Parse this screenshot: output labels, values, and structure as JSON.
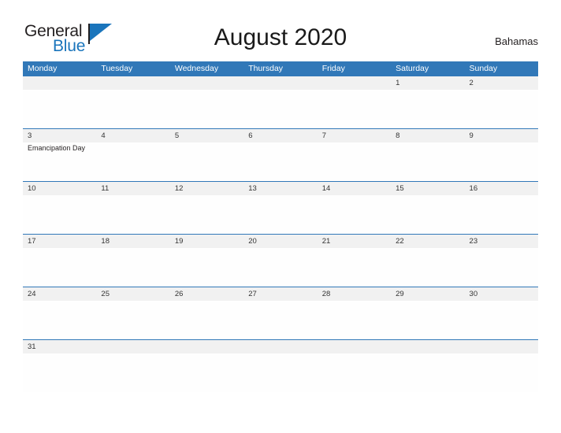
{
  "brand": {
    "name_part1": "General",
    "name_part2": "Blue",
    "flag_icon": "flag-triangle-icon",
    "color_dark": "#231f20",
    "color_blue": "#1a75bc"
  },
  "header": {
    "title": "August 2020",
    "country": "Bahamas"
  },
  "colors": {
    "header_bar": "#3178b8",
    "date_strip": "#f1f1f1",
    "row_divider": "#3178b8",
    "page_background": "#ffffff",
    "text": "#333333"
  },
  "calendar": {
    "month": "August",
    "year": "2020",
    "weekday_headers": [
      "Monday",
      "Tuesday",
      "Wednesday",
      "Thursday",
      "Friday",
      "Saturday",
      "Sunday"
    ],
    "weeks": [
      {
        "dates": [
          "",
          "",
          "",
          "",
          "",
          "1",
          "2"
        ],
        "events": [
          "",
          "",
          "",
          "",
          "",
          "",
          ""
        ]
      },
      {
        "dates": [
          "3",
          "4",
          "5",
          "6",
          "7",
          "8",
          "9"
        ],
        "events": [
          "Emancipation Day",
          "",
          "",
          "",
          "",
          "",
          ""
        ]
      },
      {
        "dates": [
          "10",
          "11",
          "12",
          "13",
          "14",
          "15",
          "16"
        ],
        "events": [
          "",
          "",
          "",
          "",
          "",
          "",
          ""
        ]
      },
      {
        "dates": [
          "17",
          "18",
          "19",
          "20",
          "21",
          "22",
          "23"
        ],
        "events": [
          "",
          "",
          "",
          "",
          "",
          "",
          ""
        ]
      },
      {
        "dates": [
          "24",
          "25",
          "26",
          "27",
          "28",
          "29",
          "30"
        ],
        "events": [
          "",
          "",
          "",
          "",
          "",
          "",
          ""
        ]
      },
      {
        "dates": [
          "31",
          "",
          "",
          "",
          "",
          "",
          ""
        ],
        "events": [
          "",
          "",
          "",
          "",
          "",
          "",
          ""
        ]
      }
    ]
  }
}
